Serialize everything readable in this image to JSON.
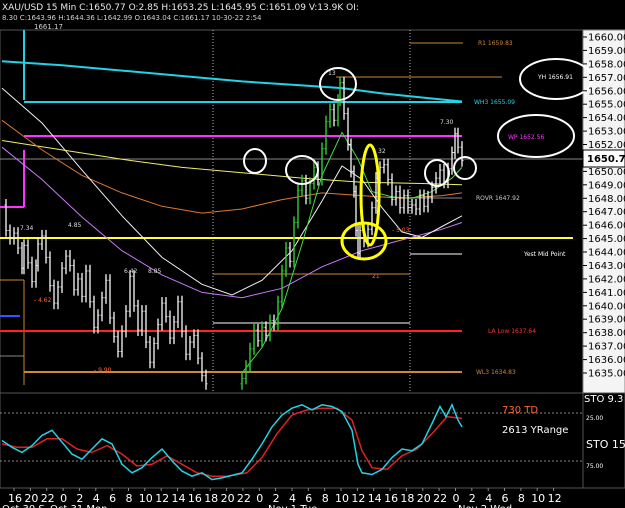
{
  "header": {
    "line1": "XAU/USD  15 Min  C:1650.77  O:2.85  H:1653.25  L:1645.95  C:1651.09  V:13.9K  OI:",
    "line2": "8.30  C:1643.96  H:1644.36  L:1642.99  O:1643.04  C:1661.17  10-30-22  2:54",
    "line3": "1661.17"
  },
  "colors": {
    "background": "#000000",
    "price_bars": "#e8e8e8",
    "price_bar_up": "#33cc33",
    "cyan_ma": "#22d3e6",
    "pivot": "#ff33ff",
    "yellow_level": "#ffff33",
    "resistance": "#cc8833",
    "support_red": "#ff2222",
    "sto_fast": "#22d3e6",
    "sto_slow": "#dd2222",
    "marker_white": "#ffffff",
    "marker_yellow": "#ffff00",
    "price_box": "#ffffff"
  },
  "price_axis": {
    "ticks": [
      "1660.00",
      "1659.00",
      "1658.00",
      "1657.00",
      "1656.00",
      "1655.00",
      "1654.00",
      "1653.00",
      "1652.00",
      "1651.00",
      "1650.00",
      "1649.00",
      "1648.00",
      "1647.00",
      "1646.00",
      "1645.00",
      "1644.00",
      "1643.00",
      "1642.00",
      "1641.00",
      "1640.00",
      "1639.00",
      "1638.00",
      "1637.00",
      "1636.00",
      "1635.00"
    ],
    "last_price": "1650.77",
    "sto_label": "STO  9.3"
  },
  "time_axis": {
    "hours": [
      "16",
      "20",
      "22",
      "0",
      "2",
      "4",
      "6",
      "8",
      "10",
      "12",
      "14",
      "16",
      "18",
      "20",
      "22",
      "0",
      "2",
      "4",
      "6",
      "8",
      "10",
      "12",
      "14",
      "16",
      "18",
      "20",
      "22",
      "0",
      "2",
      "4",
      "6",
      "8",
      "10",
      "12"
    ],
    "dates": [
      "Oct 30 S",
      "Oct 31 Mon",
      "Nov 1 Tue",
      "Nov 2 Wed"
    ]
  },
  "levels": {
    "r1": "R1  1659.83",
    "yh": "YH  1656.91",
    "wh3": "WH3  1655.09",
    "wp": "WP  1652.56",
    "rovr": "ROVR  1647.92",
    "yest_mid": "Yest Mid Point",
    "la_low": "LA Low  1637.64",
    "wl3": "WL3  1634.83"
  },
  "annotations": {
    "a_734": "7.34",
    "a_485": "4.85",
    "a_642": "6.42",
    "a_885": "8.85",
    "a_462": "- 4.62",
    "a_990": "- 9.90",
    "a_13": "13",
    "a_32": "32",
    "a_730": "7.30",
    "a_503": "- 5.03",
    "a_21": "21"
  },
  "stochastic": {
    "td": "730 TD",
    "yrange": "2613 YRange",
    "sto": "STO  15",
    "level_upper": "25.00",
    "level_lower": "75.00"
  },
  "chart_data": {
    "type": "line",
    "title": "XAU/USD 15 Min",
    "price_range": [
      1634.3,
      1660.5
    ],
    "close_path": [
      [
        0,
        1647.5
      ],
      [
        4,
        1645.6
      ],
      [
        8,
        1645.0
      ],
      [
        12,
        1645.4
      ],
      [
        16,
        1644.3
      ],
      [
        20,
        1642.8
      ],
      [
        22,
        1644.5
      ],
      [
        26,
        1643.2
      ],
      [
        30,
        1641.8
      ],
      [
        34,
        1643.0
      ],
      [
        36,
        1644.6
      ],
      [
        40,
        1645.2
      ],
      [
        44,
        1643.6
      ],
      [
        48,
        1641.5
      ],
      [
        52,
        1640.2
      ],
      [
        56,
        1641.4
      ],
      [
        60,
        1642.8
      ],
      [
        64,
        1643.7
      ],
      [
        68,
        1643.0
      ],
      [
        72,
        1641.2
      ],
      [
        76,
        1642.0
      ],
      [
        80,
        1640.7
      ],
      [
        84,
        1642.6
      ],
      [
        88,
        1640.3
      ],
      [
        92,
        1638.4
      ],
      [
        96,
        1639.3
      ],
      [
        100,
        1640.6
      ],
      [
        104,
        1641.9
      ],
      [
        108,
        1639.1
      ],
      [
        112,
        1637.7
      ],
      [
        116,
        1636.6
      ],
      [
        120,
        1638.1
      ],
      [
        124,
        1639.6
      ],
      [
        128,
        1642.2
      ],
      [
        132,
        1640.0
      ],
      [
        136,
        1638.2
      ],
      [
        140,
        1639.6
      ],
      [
        144,
        1637.3
      ],
      [
        148,
        1635.8
      ],
      [
        152,
        1637.2
      ],
      [
        156,
        1638.6
      ],
      [
        160,
        1640.2
      ],
      [
        164,
        1639.2
      ],
      [
        168,
        1637.6
      ],
      [
        172,
        1638.8
      ],
      [
        176,
        1640.3
      ],
      [
        180,
        1638.1
      ],
      [
        184,
        1636.4
      ],
      [
        188,
        1637.3
      ],
      [
        192,
        1637.8
      ],
      [
        196,
        1636.1
      ],
      [
        200,
        1634.8
      ],
      [
        204,
        1634.2
      ],
      [
        240,
        1634.6
      ],
      [
        244,
        1635.5
      ],
      [
        248,
        1636.8
      ],
      [
        252,
        1638.2
      ],
      [
        256,
        1637.4
      ],
      [
        260,
        1638.4
      ],
      [
        264,
        1637.8
      ],
      [
        268,
        1638.9
      ],
      [
        272,
        1638.6
      ],
      [
        276,
        1640.3
      ],
      [
        280,
        1642.6
      ],
      [
        284,
        1644.3
      ],
      [
        288,
        1643.3
      ],
      [
        292,
        1646.2
      ],
      [
        296,
        1648.6
      ],
      [
        300,
        1649.3
      ],
      [
        304,
        1648.0
      ],
      [
        308,
        1649.1
      ],
      [
        312,
        1650.3
      ],
      [
        316,
        1649.4
      ],
      [
        320,
        1651.7
      ],
      [
        324,
        1653.7
      ],
      [
        328,
        1654.6
      ],
      [
        332,
        1653.8
      ],
      [
        336,
        1655.3
      ],
      [
        338,
        1656.6
      ],
      [
        342,
        1654.3
      ],
      [
        346,
        1652.0
      ],
      [
        349,
        1650.0
      ],
      [
        352,
        1648.5
      ],
      [
        354,
        1645.6
      ],
      [
        356,
        1643.9
      ],
      [
        358,
        1645.6
      ],
      [
        362,
        1644.8
      ],
      [
        366,
        1645.7
      ],
      [
        370,
        1647.3
      ],
      [
        374,
        1649.5
      ],
      [
        378,
        1650.3
      ],
      [
        382,
        1650.5
      ],
      [
        386,
        1649.4
      ],
      [
        390,
        1647.9
      ],
      [
        394,
        1648.5
      ],
      [
        398,
        1647.3
      ],
      [
        402,
        1648.2
      ],
      [
        406,
        1647.3
      ],
      [
        410,
        1647.5
      ],
      [
        414,
        1647.2
      ],
      [
        418,
        1648.2
      ],
      [
        422,
        1647.4
      ],
      [
        426,
        1648.1
      ],
      [
        430,
        1648.8
      ],
      [
        434,
        1649.5
      ],
      [
        438,
        1650.1
      ],
      [
        442,
        1649.2
      ],
      [
        446,
        1650.2
      ],
      [
        450,
        1651.4
      ],
      [
        453,
        1652.8
      ],
      [
        456,
        1651.8
      ],
      [
        460,
        1650.8
      ]
    ],
    "cyan_ma": [
      [
        0,
        1658.2
      ],
      [
        60,
        1657.9
      ],
      [
        120,
        1657.5
      ],
      [
        180,
        1657.1
      ],
      [
        240,
        1656.7
      ],
      [
        300,
        1656.4
      ],
      [
        340,
        1656.2
      ],
      [
        380,
        1655.8
      ],
      [
        420,
        1655.5
      ],
      [
        460,
        1655.2
      ]
    ],
    "yellow_ma": [
      [
        0,
        1652.3
      ],
      [
        60,
        1651.6
      ],
      [
        120,
        1650.9
      ],
      [
        180,
        1650.3
      ],
      [
        240,
        1649.9
      ],
      [
        300,
        1649.5
      ],
      [
        360,
        1649.2
      ],
      [
        420,
        1649.1
      ],
      [
        460,
        1649.0
      ]
    ],
    "orange_ma": [
      [
        0,
        1653.8
      ],
      [
        40,
        1651.6
      ],
      [
        80,
        1649.7
      ],
      [
        120,
        1648.4
      ],
      [
        160,
        1647.4
      ],
      [
        200,
        1646.9
      ],
      [
        240,
        1647.2
      ],
      [
        280,
        1647.9
      ],
      [
        320,
        1648.4
      ],
      [
        360,
        1648.2
      ],
      [
        400,
        1648.0
      ],
      [
        440,
        1648.2
      ],
      [
        460,
        1648.4
      ]
    ],
    "purple_ma": [
      [
        0,
        1651.8
      ],
      [
        40,
        1649.4
      ],
      [
        80,
        1646.6
      ],
      [
        120,
        1644.1
      ],
      [
        160,
        1642.3
      ],
      [
        200,
        1641.0
      ],
      [
        240,
        1640.6
      ],
      [
        280,
        1641.3
      ],
      [
        320,
        1642.9
      ],
      [
        360,
        1644.1
      ],
      [
        400,
        1644.9
      ],
      [
        440,
        1645.7
      ],
      [
        460,
        1646.2
      ]
    ],
    "white_ma": [
      [
        0,
        1656.2
      ],
      [
        40,
        1653.6
      ],
      [
        80,
        1650.1
      ],
      [
        120,
        1646.7
      ],
      [
        160,
        1643.6
      ],
      [
        200,
        1641.6
      ],
      [
        230,
        1640.8
      ],
      [
        260,
        1641.9
      ],
      [
        290,
        1644.1
      ],
      [
        320,
        1647.8
      ],
      [
        340,
        1650.4
      ],
      [
        360,
        1649.4
      ],
      [
        380,
        1647.3
      ],
      [
        400,
        1645.5
      ],
      [
        420,
        1645.1
      ],
      [
        440,
        1645.9
      ],
      [
        460,
        1646.7
      ]
    ],
    "green_ma": [
      [
        240,
        1635.0
      ],
      [
        260,
        1636.9
      ],
      [
        280,
        1639.8
      ],
      [
        300,
        1644.6
      ],
      [
        320,
        1649.7
      ],
      [
        340,
        1652.9
      ],
      [
        356,
        1650.9
      ],
      [
        370,
        1648.5
      ],
      [
        390,
        1648.1
      ],
      [
        410,
        1648.0
      ],
      [
        430,
        1648.5
      ],
      [
        450,
        1649.5
      ],
      [
        460,
        1650.3
      ]
    ],
    "sto_fast": [
      [
        0,
        50
      ],
      [
        10,
        42
      ],
      [
        20,
        36
      ],
      [
        30,
        44
      ],
      [
        40,
        56
      ],
      [
        50,
        62
      ],
      [
        60,
        48
      ],
      [
        70,
        34
      ],
      [
        80,
        28
      ],
      [
        90,
        40
      ],
      [
        100,
        52
      ],
      [
        110,
        46
      ],
      [
        120,
        22
      ],
      [
        130,
        12
      ],
      [
        140,
        18
      ],
      [
        150,
        30
      ],
      [
        160,
        40
      ],
      [
        170,
        26
      ],
      [
        180,
        14
      ],
      [
        190,
        8
      ],
      [
        200,
        12
      ],
      [
        210,
        4
      ],
      [
        220,
        6
      ],
      [
        240,
        12
      ],
      [
        250,
        28
      ],
      [
        260,
        46
      ],
      [
        270,
        66
      ],
      [
        280,
        80
      ],
      [
        290,
        88
      ],
      [
        300,
        92
      ],
      [
        310,
        86
      ],
      [
        320,
        92
      ],
      [
        330,
        90
      ],
      [
        340,
        84
      ],
      [
        350,
        62
      ],
      [
        356,
        22
      ],
      [
        360,
        12
      ],
      [
        370,
        10
      ],
      [
        380,
        16
      ],
      [
        390,
        30
      ],
      [
        400,
        40
      ],
      [
        410,
        38
      ],
      [
        420,
        46
      ],
      [
        430,
        70
      ],
      [
        438,
        90
      ],
      [
        444,
        78
      ],
      [
        450,
        92
      ],
      [
        456,
        74
      ],
      [
        460,
        66
      ]
    ],
    "sto_slow": [
      [
        0,
        46
      ],
      [
        15,
        42
      ],
      [
        30,
        42
      ],
      [
        45,
        52
      ],
      [
        60,
        52
      ],
      [
        75,
        40
      ],
      [
        90,
        36
      ],
      [
        105,
        44
      ],
      [
        120,
        34
      ],
      [
        135,
        20
      ],
      [
        150,
        22
      ],
      [
        165,
        32
      ],
      [
        180,
        22
      ],
      [
        195,
        12
      ],
      [
        210,
        8
      ],
      [
        225,
        8
      ],
      [
        245,
        12
      ],
      [
        260,
        30
      ],
      [
        275,
        58
      ],
      [
        290,
        80
      ],
      [
        305,
        86
      ],
      [
        320,
        88
      ],
      [
        335,
        88
      ],
      [
        350,
        74
      ],
      [
        360,
        38
      ],
      [
        370,
        18
      ],
      [
        385,
        16
      ],
      [
        400,
        32
      ],
      [
        415,
        40
      ],
      [
        430,
        58
      ],
      [
        445,
        78
      ],
      [
        460,
        76
      ]
    ]
  }
}
